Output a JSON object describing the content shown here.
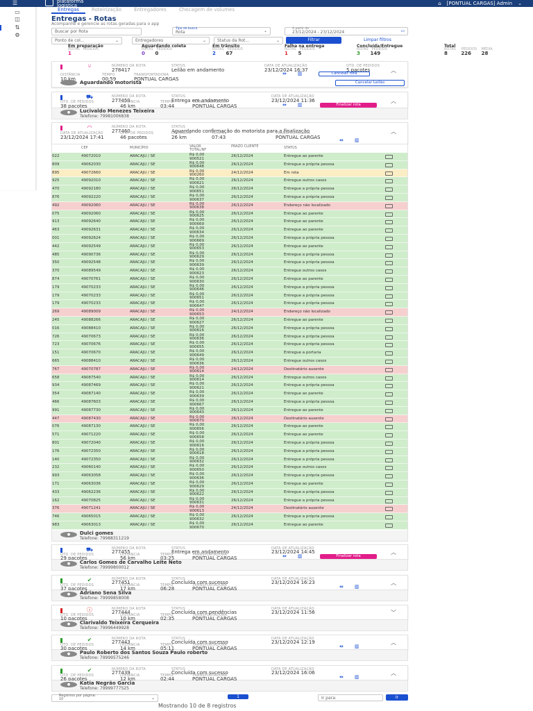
{
  "app": {
    "brand_line1": "plataforma",
    "brand_line2": "logistica",
    "user": "[PONTUAL CARGAS] Admin"
  },
  "tabs": [
    {
      "label": "Entregas",
      "active": true
    },
    {
      "label": "Roteirização",
      "active": false
    },
    {
      "label": "Entregadores",
      "active": false
    },
    {
      "label": "Checagem de volumes",
      "active": false
    }
  ],
  "page": {
    "title": "Entregas - Rotas",
    "subtitle": "Acompanhe e gerencie as rotas geradas para o app"
  },
  "filters": {
    "search_placeholder": "Buscar por Rota",
    "search_type": "Tipo de busca",
    "search_type_value": "Rota",
    "date_label": "A partir de",
    "date_value": "23/12/2024 - 23/12/2024",
    "ponto_coleta": "Ponto de col...",
    "entregadores": "Entregadores",
    "status_rota": "Status da Rot...",
    "filter_btn": "Filtrar",
    "clear_btn": "Limpar filtros"
  },
  "stats": [
    {
      "title": "Em preparação",
      "h1": "ROTAS",
      "h2": "PEDIDOS",
      "v1": "1",
      "v2": "",
      "c1": "#e21d8a"
    },
    {
      "title": "Aguardando coleta",
      "h1": "ROTAS",
      "h2": "PEDIDOS",
      "v1": "0",
      "v2": "0",
      "c1": "#7c3cc8"
    },
    {
      "title": "Em trânsito",
      "h1": "ROTAS",
      "h2": "PEDIDOS",
      "v1": "2",
      "v2": "67",
      "c1": "#1a4fd0"
    },
    {
      "title": "Falha na entrega",
      "h1": "ROTAS",
      "h2": "PEDIDOS",
      "v1": "1",
      "v2": "5",
      "c1": "#d62020"
    },
    {
      "title": "Concluída/Entregue",
      "h1": "ROTAS",
      "h2": "PEDIDOS",
      "v1": "3",
      "v2": "149",
      "c1": "#2a9a2a"
    },
    {
      "title": "Total",
      "h1": "ROTAS",
      "h2": "PEDIDOS",
      "h3": "MÉDIA",
      "v1": "8",
      "v2": "226",
      "v3": "28",
      "c1": "#333"
    }
  ],
  "labels": {
    "numero_rota": "NÚMERO DA ROTA",
    "status": "STATUS",
    "data_atualizacao": "DATA DE ATUALIZAÇÃO",
    "qtd_pedidos": "QTD. DE PEDIDOS",
    "distancia": "DISTÂNCIA",
    "tempo": "TEMPO",
    "transportadora": "TRANSPORTADORA"
  },
  "route1": {
    "numero": "278417",
    "status": "Leilão em andamento",
    "data": "23/12/2024 16:37",
    "qtd": "5 pacotes",
    "distancia": "10 km",
    "tempo": "00:59",
    "transportadora": "PONTUAL CARGAS",
    "btn1": "Cancelar rota",
    "btn2": "Cancelar Leilão",
    "foot_name": "Aguardando motorista",
    "color": "#e21d8a"
  },
  "route2": {
    "numero": "277459",
    "status": "Entrega em andamento",
    "data": "23/12/2024 11:36",
    "qtd": "38 pacotes",
    "distancia": "46 km",
    "tempo": "03:44",
    "transportadora": "PONTUAL CARGAS",
    "btn1": "Finalizar rota",
    "foot_name": "Lucivaldo Menezes Teixeira",
    "foot_tel": "Telefone: 79981006838",
    "color": "#1a4fd0"
  },
  "route3": {
    "numero": "277460",
    "status": "Aguardando confirmação do motorista para a finalização",
    "data": "23/12/2024 17:41",
    "qtd": "46 pacotes",
    "distancia": "26 km",
    "tempo": "07:43",
    "transportadora": "PONTUAL CARGAS",
    "color": "#e21d8a"
  },
  "table_headers": {
    "cep": "CEP",
    "municipio": "MUNICÍPIO",
    "valor": "VALOR TOTAL/NF",
    "prazo": "PRAZO CLIENTE",
    "status": "STATUS"
  },
  "table_rows": [
    {
      "cod": "022",
      "cep": "49072010",
      "mun": "ARACAJU / SE",
      "valor": "R$ 0,00",
      "nf": "900521",
      "prazo": "26/12/2024",
      "status": "Entregue ao parente",
      "tone": "green"
    },
    {
      "cod": "809",
      "cep": "49062030",
      "mun": "ARACAJU / SE",
      "valor": "R$ 0,00",
      "nf": "900648",
      "prazo": "26/12/2024",
      "status": "Entregue a própria pessoa",
      "tone": "green"
    },
    {
      "cod": "895",
      "cep": "49072660",
      "mun": "ARACAJU / SE",
      "valor": "R$ 0,00",
      "nf": "900260",
      "prazo": "24/12/2024",
      "status": "Em rota",
      "tone": "yellow"
    },
    {
      "cod": "925",
      "cep": "49092010",
      "mun": "ARACAJU / SE",
      "valor": "R$ 0,00",
      "nf": "900621",
      "prazo": "26/12/2024",
      "status": "Entregue outros casos",
      "tone": "green"
    },
    {
      "cod": "470",
      "cep": "49092180",
      "mun": "ARACAJU / SE",
      "valor": "R$ 0,00",
      "nf": "900651",
      "prazo": "26/12/2024",
      "status": "Entregue a própria pessoa",
      "tone": "green"
    },
    {
      "cod": "876",
      "cep": "49092220",
      "mun": "ARACAJU / SE",
      "valor": "R$ 0,00",
      "nf": "900637",
      "prazo": "26/12/2024",
      "status": "Entregue a própria pessoa",
      "tone": "green"
    },
    {
      "cod": "492",
      "cep": "49092060",
      "mun": "ARACAJU / SE",
      "valor": "R$ 0,00",
      "nf": "900638",
      "prazo": "26/12/2024",
      "status": "Endereço não localizado",
      "tone": "red"
    },
    {
      "cod": "075",
      "cep": "49092060",
      "mun": "ARACAJU / SE",
      "valor": "R$ 0,00",
      "nf": "900625",
      "prazo": "26/12/2024",
      "status": "Entregue ao parente",
      "tone": "green"
    },
    {
      "cod": "913",
      "cep": "49092640",
      "mun": "ARACAJU / SE",
      "valor": "R$ 0,00",
      "nf": "900669",
      "prazo": "26/12/2024",
      "status": "Entregue ao parente",
      "tone": "green"
    },
    {
      "cod": "463",
      "cep": "49092631",
      "mun": "ARACAJU / SE",
      "valor": "R$ 0,00",
      "nf": "900634",
      "prazo": "26/12/2024",
      "status": "Entregue ao parente",
      "tone": "green"
    },
    {
      "cod": "001",
      "cep": "49092624",
      "mun": "ARACAJU / SE",
      "valor": "R$ 0,00",
      "nf": "900669",
      "prazo": "26/12/2024",
      "status": "Entregue a própria pessoa",
      "tone": "green"
    },
    {
      "cod": "442",
      "cep": "49092549",
      "mun": "ARACAJU / SE",
      "valor": "R$ 0,00",
      "nf": "900653",
      "prazo": "26/12/2024",
      "status": "Entregue ao parente",
      "tone": "green"
    },
    {
      "cod": "485",
      "cep": "49090736",
      "mun": "ARACAJU / SE",
      "valor": "R$ 0,00",
      "nf": "900629",
      "prazo": "26/12/2024",
      "status": "Entregue a própria pessoa",
      "tone": "green"
    },
    {
      "cod": "350",
      "cep": "49092548",
      "mun": "ARACAJU / SE",
      "valor": "R$ 0,00",
      "nf": "900639",
      "prazo": "26/12/2024",
      "status": "Entregue a própria pessoa",
      "tone": "green"
    },
    {
      "cod": "370",
      "cep": "49089549",
      "mun": "ARACAJU / SE",
      "valor": "R$ 0,00",
      "nf": "900623",
      "prazo": "26/12/2024",
      "status": "Entregue outros casos",
      "tone": "green"
    },
    {
      "cod": "874",
      "cep": "49070761",
      "mun": "ARACAJU / SE",
      "valor": "R$ 0,00",
      "nf": "900630",
      "prazo": "26/12/2024",
      "status": "Entregue ao parente",
      "tone": "green"
    },
    {
      "cod": "179",
      "cep": "49070233",
      "mun": "ARACAJU / SE",
      "valor": "R$ 0,00",
      "nf": "900646",
      "prazo": "26/12/2024",
      "status": "Entregue a própria pessoa",
      "tone": "green"
    },
    {
      "cod": "179",
      "cep": "49070233",
      "mun": "ARACAJU / SE",
      "valor": "R$ 0,00",
      "nf": "900651",
      "prazo": "26/12/2024",
      "status": "Entregue a própria pessoa",
      "tone": "green"
    },
    {
      "cod": "179",
      "cep": "49070233",
      "mun": "ARACAJU / SE",
      "valor": "R$ 0,00",
      "nf": "900647",
      "prazo": "26/12/2024",
      "status": "Entregue a própria pessoa",
      "tone": "green"
    },
    {
      "cod": "269",
      "cep": "49089009",
      "mun": "ARACAJU / SE",
      "valor": "R$ 0,00",
      "nf": "900653",
      "prazo": "24/12/2024",
      "status": "Endereço não localizado",
      "tone": "red"
    },
    {
      "cod": "245",
      "cep": "49088266",
      "mun": "ARACAJU / SE",
      "valor": "R$ 0,00",
      "nf": "900627",
      "prazo": "26/12/2024",
      "status": "Entregue ao parente",
      "tone": "green"
    },
    {
      "cod": "016",
      "cep": "49088410",
      "mun": "ARACAJU / SE",
      "valor": "R$ 0,00",
      "nf": "900616",
      "prazo": "26/12/2024",
      "status": "Entregue a própria pessoa",
      "tone": "green"
    },
    {
      "cod": "726",
      "cep": "49070673",
      "mun": "ARACAJU / SE",
      "valor": "R$ 0,00",
      "nf": "900636",
      "prazo": "26/12/2024",
      "status": "Entregue a própria pessoa",
      "tone": "green"
    },
    {
      "cod": "723",
      "cep": "49070676",
      "mun": "ARACAJU / SE",
      "valor": "R$ 0,00",
      "nf": "900655",
      "prazo": "26/12/2024",
      "status": "Entregue a própria pessoa",
      "tone": "green"
    },
    {
      "cod": "151",
      "cep": "49070670",
      "mun": "ARACAJU / SE",
      "valor": "R$ 0,00",
      "nf": "900649",
      "prazo": "26/12/2024",
      "status": "Entregue a portaria",
      "tone": "green"
    },
    {
      "cod": "665",
      "cep": "49088410",
      "mun": "ARACAJU / SE",
      "valor": "R$ 0,00",
      "nf": "900636",
      "prazo": "26/12/2024",
      "status": "Entregue outros casos",
      "tone": "green"
    },
    {
      "cod": "767",
      "cep": "49070787",
      "mun": "ARACAJU / SE",
      "valor": "R$ 0,00",
      "nf": "900614",
      "prazo": "24/12/2024",
      "status": "Destinatário ausente",
      "tone": "red"
    },
    {
      "cod": "658",
      "cep": "49087540",
      "mun": "ARACAJU / SE",
      "valor": "R$ 0,00",
      "nf": "900614",
      "prazo": "26/12/2024",
      "status": "Entregue outros casos",
      "tone": "green"
    },
    {
      "cod": "934",
      "cep": "49087469",
      "mun": "ARACAJU / SE",
      "valor": "R$ 0,00",
      "nf": "900621",
      "prazo": "26/12/2024",
      "status": "Entregue a própria pessoa",
      "tone": "green"
    },
    {
      "cod": "354",
      "cep": "49087140",
      "mun": "ARACAJU / SE",
      "valor": "R$ 0,00",
      "nf": "900639",
      "prazo": "26/12/2024",
      "status": "Entregue ao parente",
      "tone": "green"
    },
    {
      "cod": "466",
      "cep": "49087603",
      "mun": "ARACAJU / SE",
      "valor": "R$ 0,00",
      "nf": "900667",
      "prazo": "26/12/2024",
      "status": "Entregue a própria pessoa",
      "tone": "green"
    },
    {
      "cod": "991",
      "cep": "49087730",
      "mun": "ARACAJU / SE",
      "valor": "R$ 0,00",
      "nf": "900643",
      "prazo": "26/12/2024",
      "status": "Entregue ao parente",
      "tone": "green"
    },
    {
      "cod": "447",
      "cep": "49087430",
      "mun": "ARACAJU / SE",
      "valor": "R$ 0,00",
      "nf": "900670",
      "prazo": "26/12/2024",
      "status": "Destinatário ausente",
      "tone": "red"
    },
    {
      "cod": "076",
      "cep": "49087130",
      "mun": "ARACAJU / SE",
      "valor": "R$ 0,00",
      "nf": "900656",
      "prazo": "26/12/2024",
      "status": "Entregue ao parente",
      "tone": "green"
    },
    {
      "cod": "571",
      "cep": "49071220",
      "mun": "ARACAJU / SE",
      "valor": "R$ 0,00",
      "nf": "900658",
      "prazo": "26/12/2024",
      "status": "Entregue ao parente",
      "tone": "green"
    },
    {
      "cod": "801",
      "cep": "49072040",
      "mun": "ARACAJU / SE",
      "valor": "R$ 0,00",
      "nf": "900616",
      "prazo": "26/12/2024",
      "status": "Entregue a própria pessoa",
      "tone": "green"
    },
    {
      "cod": "176",
      "cep": "49072350",
      "mun": "ARACAJU / SE",
      "valor": "R$ 0,00",
      "nf": "900618",
      "prazo": "26/12/2024",
      "status": "Entregue a própria pessoa",
      "tone": "green"
    },
    {
      "cod": "140",
      "cep": "49072350",
      "mun": "ARACAJU / SE",
      "valor": "R$ 0,00",
      "nf": "900632",
      "prazo": "26/12/2024",
      "status": "Entregue a própria pessoa",
      "tone": "green"
    },
    {
      "cod": "232",
      "cep": "49060140",
      "mun": "ARACAJU / SE",
      "valor": "R$ 0,00",
      "nf": "900650",
      "prazo": "26/12/2024",
      "status": "Entregue outros casos",
      "tone": "green"
    },
    {
      "cod": "993",
      "cep": "49063058",
      "mun": "ARACAJU / SE",
      "valor": "R$ 0,00",
      "nf": "900636",
      "prazo": "26/12/2024",
      "status": "Entregue a própria pessoa",
      "tone": "green"
    },
    {
      "cod": "171",
      "cep": "49063036",
      "mun": "ARACAJU / SE",
      "valor": "R$ 0,00",
      "nf": "900629",
      "prazo": "26/12/2024",
      "status": "Entregue ao parente",
      "tone": "green"
    },
    {
      "cod": "433",
      "cep": "49062236",
      "mun": "ARACAJU / SE",
      "valor": "R$ 0,00",
      "nf": "900622",
      "prazo": "26/12/2024",
      "status": "Entregue a própria pessoa",
      "tone": "green"
    },
    {
      "cod": "162",
      "cep": "49070825",
      "mun": "ARACAJU / SE",
      "valor": "R$ 0,00",
      "nf": "900631",
      "prazo": "26/12/2024",
      "status": "Entregue a própria pessoa",
      "tone": "green"
    },
    {
      "cod": "376",
      "cep": "49071241",
      "mun": "ARACAJU / SE",
      "valor": "R$ 0,00",
      "nf": "900613",
      "prazo": "24/12/2024",
      "status": "Destinatário ausente",
      "tone": "red"
    },
    {
      "cod": "746",
      "cep": "49065015",
      "mun": "ARACAJU / SE",
      "valor": "R$ 0,00",
      "nf": "900632",
      "prazo": "26/12/2024",
      "status": "Entregue a própria pessoa",
      "tone": "green"
    },
    {
      "cod": "983",
      "cep": "49063013",
      "mun": "ARACAJU / SE",
      "valor": "R$ 0,00",
      "nf": "900670",
      "prazo": "26/12/2024",
      "status": "Entregue ao parente",
      "tone": "green"
    }
  ],
  "route3_foot": {
    "name": "Dulci gomes",
    "tel": "Telefone: 79988311219"
  },
  "route4": {
    "numero": "277455",
    "status": "Entrega em andamento",
    "data": "23/12/2024 14:45",
    "qtd": "29 pacotes",
    "distancia": "56 km",
    "tempo": "03:25",
    "transportadora": "PONTUAL CARGAS",
    "btn1": "Finalizar rota",
    "foot_name": "Carlos Gomes de Carvalho Leite Neto",
    "foot_tel": "Telefone: 79999800012",
    "color": "#1a4fd0"
  },
  "route5": {
    "numero": "277451",
    "status": "Concluída com sucesso",
    "data": "23/12/2024 16:23",
    "qtd": "37 pacotes",
    "distancia": "17 km",
    "tempo": "06:28",
    "transportadora": "PONTUAL CARGAS",
    "foot_name": "Adriano Sena Silva",
    "foot_tel": "Telefone: 79999858008",
    "color": "#2a9a2a"
  },
  "route6": {
    "numero": "277444",
    "status": "Concluída com pendências",
    "data": "23/12/2024 11:56",
    "qtd": "10 pacotes",
    "distancia": "10 km",
    "tempo": "02:35",
    "transportadora": "PONTUAL CARGAS",
    "foot_name": "Clarivaldo Teixeira Cerqueira",
    "foot_tel": "Telefone: 79996449928",
    "color": "#d62020"
  },
  "route7": {
    "numero": "277443",
    "status": "Concluída com sucesso",
    "data": "23/12/2024 12:19",
    "qtd": "30 pacotes",
    "distancia": "14 km",
    "tempo": "05:11",
    "transportadora": "PONTUAL CARGAS",
    "foot_name": "Paulo Roberto dos Santos Souza Paulo roberto",
    "foot_tel": "Telefone: 79999575246",
    "color": "#2a9a2a"
  },
  "route8": {
    "numero": "277439",
    "status": "Concluída com sucesso",
    "data": "23/12/2024 16:06",
    "qtd": "26 pacotes",
    "distancia": "12 km",
    "tempo": "02:44",
    "transportadora": "PONTUAL CARGAS",
    "foot_name": "Katia Negrão Garcia",
    "foot_tel": "Telefone: 79999777525",
    "color": "#2a9a2a"
  },
  "pagination": {
    "per_page_label": "Registros por página:",
    "per_page": "10",
    "current_page": "1",
    "goto_placeholder": "Ir para:",
    "goto_btn": "Ir",
    "summary": "Mostrando 10 de 8 registros"
  }
}
